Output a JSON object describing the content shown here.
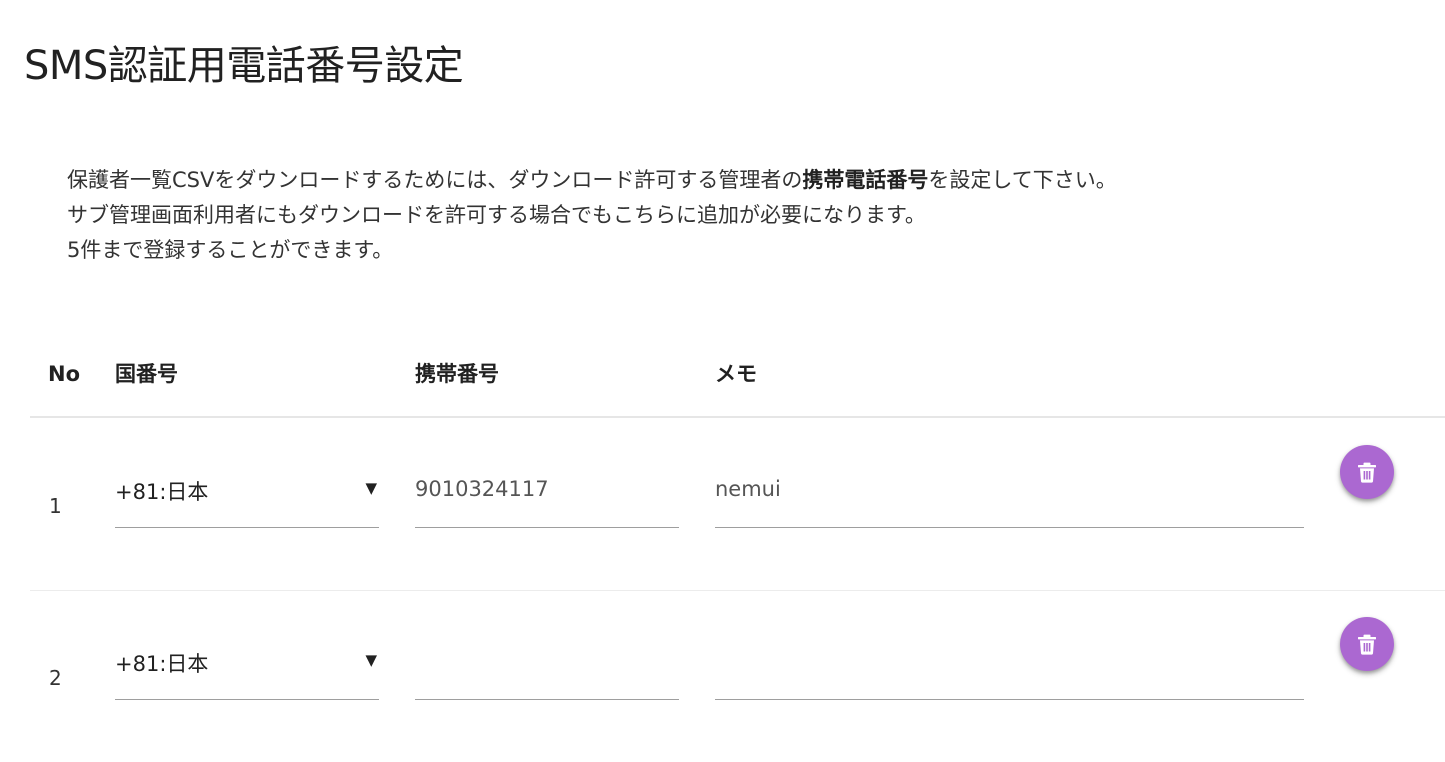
{
  "page": {
    "title": "SMS認証用電話番号設定"
  },
  "description": {
    "line1_before": "保護者一覧CSVをダウンロードするためには、ダウンロード許可する管理者の",
    "line1_bold": "携帯電話番号",
    "line1_after": "を設定して下さい。",
    "line2": "サブ管理画面利用者にもダウンロードを許可する場合でもこちらに追加が必要になります。",
    "line3": "5件まで登録することができます。"
  },
  "table": {
    "headers": {
      "no": "No",
      "country_code": "国番号",
      "mobile_number": "携帯番号",
      "memo": "メモ"
    },
    "rows": [
      {
        "no": "1",
        "country": "+81:日本",
        "phone": "9010324117",
        "memo": "nemui"
      },
      {
        "no": "2",
        "country": "+81:日本",
        "phone": "",
        "memo": ""
      }
    ]
  },
  "icons": {
    "select_arrow": "▼",
    "delete": "trash-icon"
  },
  "colors": {
    "delete_button": "#ab68d1",
    "text": "#212121",
    "underline": "#9e9e9e"
  }
}
